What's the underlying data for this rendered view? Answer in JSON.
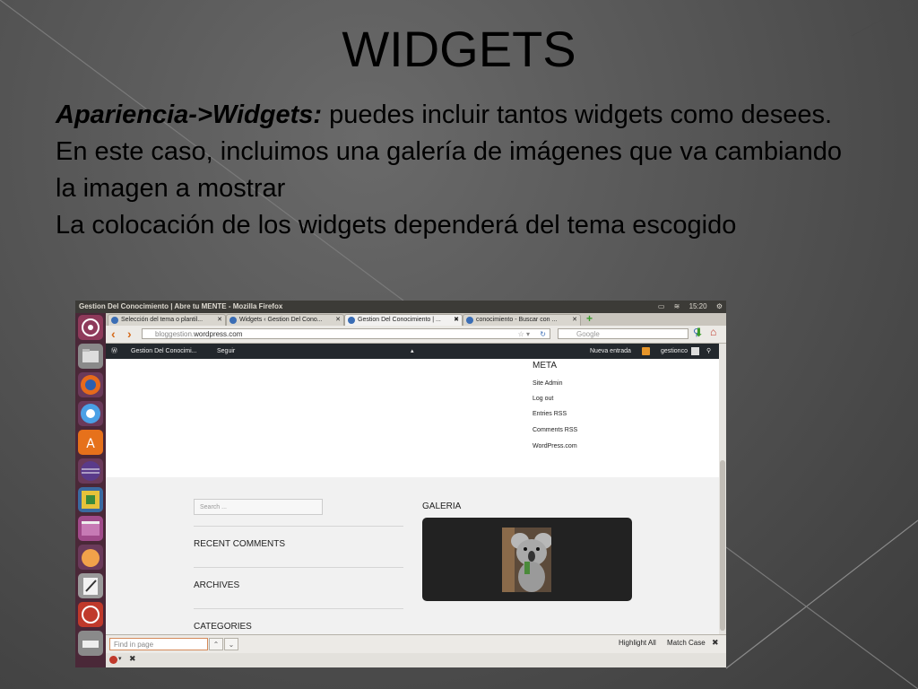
{
  "slide": {
    "title": "WIDGETS",
    "line1_bold": "Apariencia->Widgets:",
    "line1_rest": " puedes incluir tantos widgets como desees.",
    "line2": "En este caso, incluimos una galería de imágenes que va cambiando la imagen a mostrar",
    "line3": "La colocación de los widgets dependerá del tema escogido"
  },
  "screenshot": {
    "window_title": "Gestion Del Conocimiento | Abre tu MENTE - Mozilla Firefox",
    "clock": "15:20",
    "tabs": [
      {
        "label": "Selección del tema o plantil..."
      },
      {
        "label": "Widgets ‹ Gestion Del Cono..."
      },
      {
        "label": "Gestion Del Conocimiento | ..."
      },
      {
        "label": "conocimiento - Buscar con ..."
      }
    ],
    "url_host": "bloggestion.",
    "url_domain": "wordpress.com",
    "search_placeholder": "Google",
    "wp_bar": {
      "site_name": "Gestion Del Conocimi...",
      "follow": "Seguir",
      "new_post": "Nueva entrada",
      "user": "gestionco"
    },
    "meta": {
      "title": "META",
      "links": [
        "Site Admin",
        "Log out",
        "Entries RSS",
        "Comments RSS",
        "WordPress.com"
      ]
    },
    "widgets": {
      "search_placeholder": "Search ...",
      "recent_comments": "RECENT COMMENTS",
      "archives": "ARCHIVES",
      "categories": "CATEGORIES",
      "galeria": "GALERIA"
    },
    "findbar": {
      "placeholder": "Find in page",
      "highlight_all": "Highlight All",
      "match_case": "Match Case"
    }
  }
}
